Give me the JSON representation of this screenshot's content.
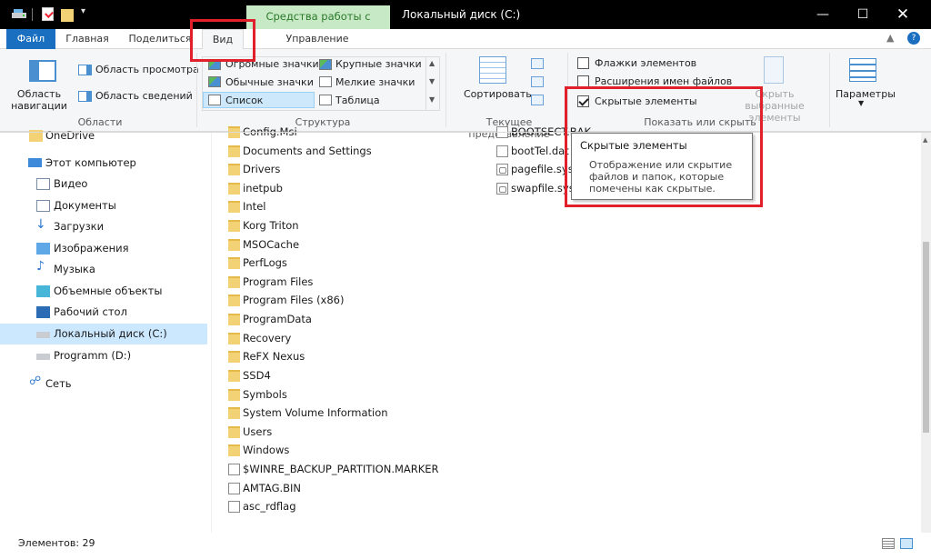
{
  "titlebar": {
    "contextual_tab": "Средства работы с дисками",
    "title": "Локальный диск (C:)",
    "minimize": "—",
    "maximize": "☐",
    "close": "✕"
  },
  "tabs": {
    "file": "Файл",
    "home": "Главная",
    "share": "Поделиться",
    "view": "Вид",
    "manage": "Управление",
    "help_up": "▲",
    "help_q": "?"
  },
  "ribbon": {
    "areas": {
      "nav_pane": "Область навигации",
      "preview_pane": "Область просмотра",
      "details_pane": "Область сведений",
      "label": "Области"
    },
    "structure": {
      "huge_icons": "Огромные значки",
      "large_icons": "Крупные значки",
      "normal_icons": "Обычные значки",
      "small_icons": "Мелкие значки",
      "list": "Список",
      "table": "Таблица",
      "label": "Структура"
    },
    "current_view": {
      "sort": "Сортировать",
      "label": "Текущее представление"
    },
    "show_hide": {
      "item_checkboxes": "Флажки элементов",
      "file_extensions": "Расширения имен файлов",
      "hidden_items": "Скрытые элементы",
      "hide_selected": "Скрыть выбранные элементы",
      "label": "Показать или скрыть",
      "item_checkboxes_checked": false,
      "file_extensions_checked": false,
      "hidden_items_checked": true
    },
    "options": {
      "label": "Параметры"
    }
  },
  "nav": {
    "items": [
      {
        "label": "OneDrive",
        "icon": "onedrive-icon"
      },
      {
        "label": "Этот компьютер",
        "icon": "this-pc-icon"
      },
      {
        "label": "Видео",
        "icon": "video-icon"
      },
      {
        "label": "Документы",
        "icon": "documents-icon"
      },
      {
        "label": "Загрузки",
        "icon": "downloads-icon"
      },
      {
        "label": "Изображения",
        "icon": "pictures-icon"
      },
      {
        "label": "Музыка",
        "icon": "music-icon"
      },
      {
        "label": "Объемные объекты",
        "icon": "3d-objects-icon"
      },
      {
        "label": "Рабочий стол",
        "icon": "desktop-icon"
      },
      {
        "label": "Локальный диск (C:)",
        "icon": "local-disk-icon",
        "selected": true
      },
      {
        "label": "Programm (D:)",
        "icon": "drive-icon"
      },
      {
        "label": "Сеть",
        "icon": "network-icon"
      }
    ]
  },
  "files": {
    "col1": [
      {
        "name": "Config.Msi",
        "type": "folder"
      },
      {
        "name": "Documents and Settings",
        "type": "folder-link"
      },
      {
        "name": "Drivers",
        "type": "folder"
      },
      {
        "name": "inetpub",
        "type": "folder"
      },
      {
        "name": "Intel",
        "type": "folder"
      },
      {
        "name": "Korg Triton",
        "type": "folder"
      },
      {
        "name": "MSOCache",
        "type": "folder"
      },
      {
        "name": "PerfLogs",
        "type": "folder"
      },
      {
        "name": "Program Files",
        "type": "folder"
      },
      {
        "name": "Program Files (x86)",
        "type": "folder"
      },
      {
        "name": "ProgramData",
        "type": "folder"
      },
      {
        "name": "Recovery",
        "type": "folder"
      },
      {
        "name": "ReFX Nexus",
        "type": "folder"
      },
      {
        "name": "SSD4",
        "type": "folder"
      },
      {
        "name": "Symbols",
        "type": "folder"
      },
      {
        "name": "System Volume Information",
        "type": "folder"
      },
      {
        "name": "Users",
        "type": "folder"
      },
      {
        "name": "Windows",
        "type": "folder"
      },
      {
        "name": "$WINRE_BACKUP_PARTITION.MARKER",
        "type": "file"
      },
      {
        "name": "AMTAG.BIN",
        "type": "file"
      },
      {
        "name": "asc_rdflag",
        "type": "file"
      }
    ],
    "col2": [
      {
        "name": "BOOTSECT.BAK",
        "type": "file"
      },
      {
        "name": "bootTel.dat",
        "type": "file"
      },
      {
        "name": "pagefile.sys",
        "type": "sys"
      },
      {
        "name": "swapfile.sys",
        "type": "sys"
      }
    ]
  },
  "tooltip": {
    "title": "Скрытые элементы",
    "body": "Отображение или скрытие файлов и папок, которые помечены как скрытые."
  },
  "status": {
    "items_count": "Элементов: 29"
  },
  "colors": {
    "accent": "#1a6fc1",
    "highlight": "#e0202b",
    "selection": "#cce8ff",
    "contextual_tab": "#c8e9c5"
  }
}
